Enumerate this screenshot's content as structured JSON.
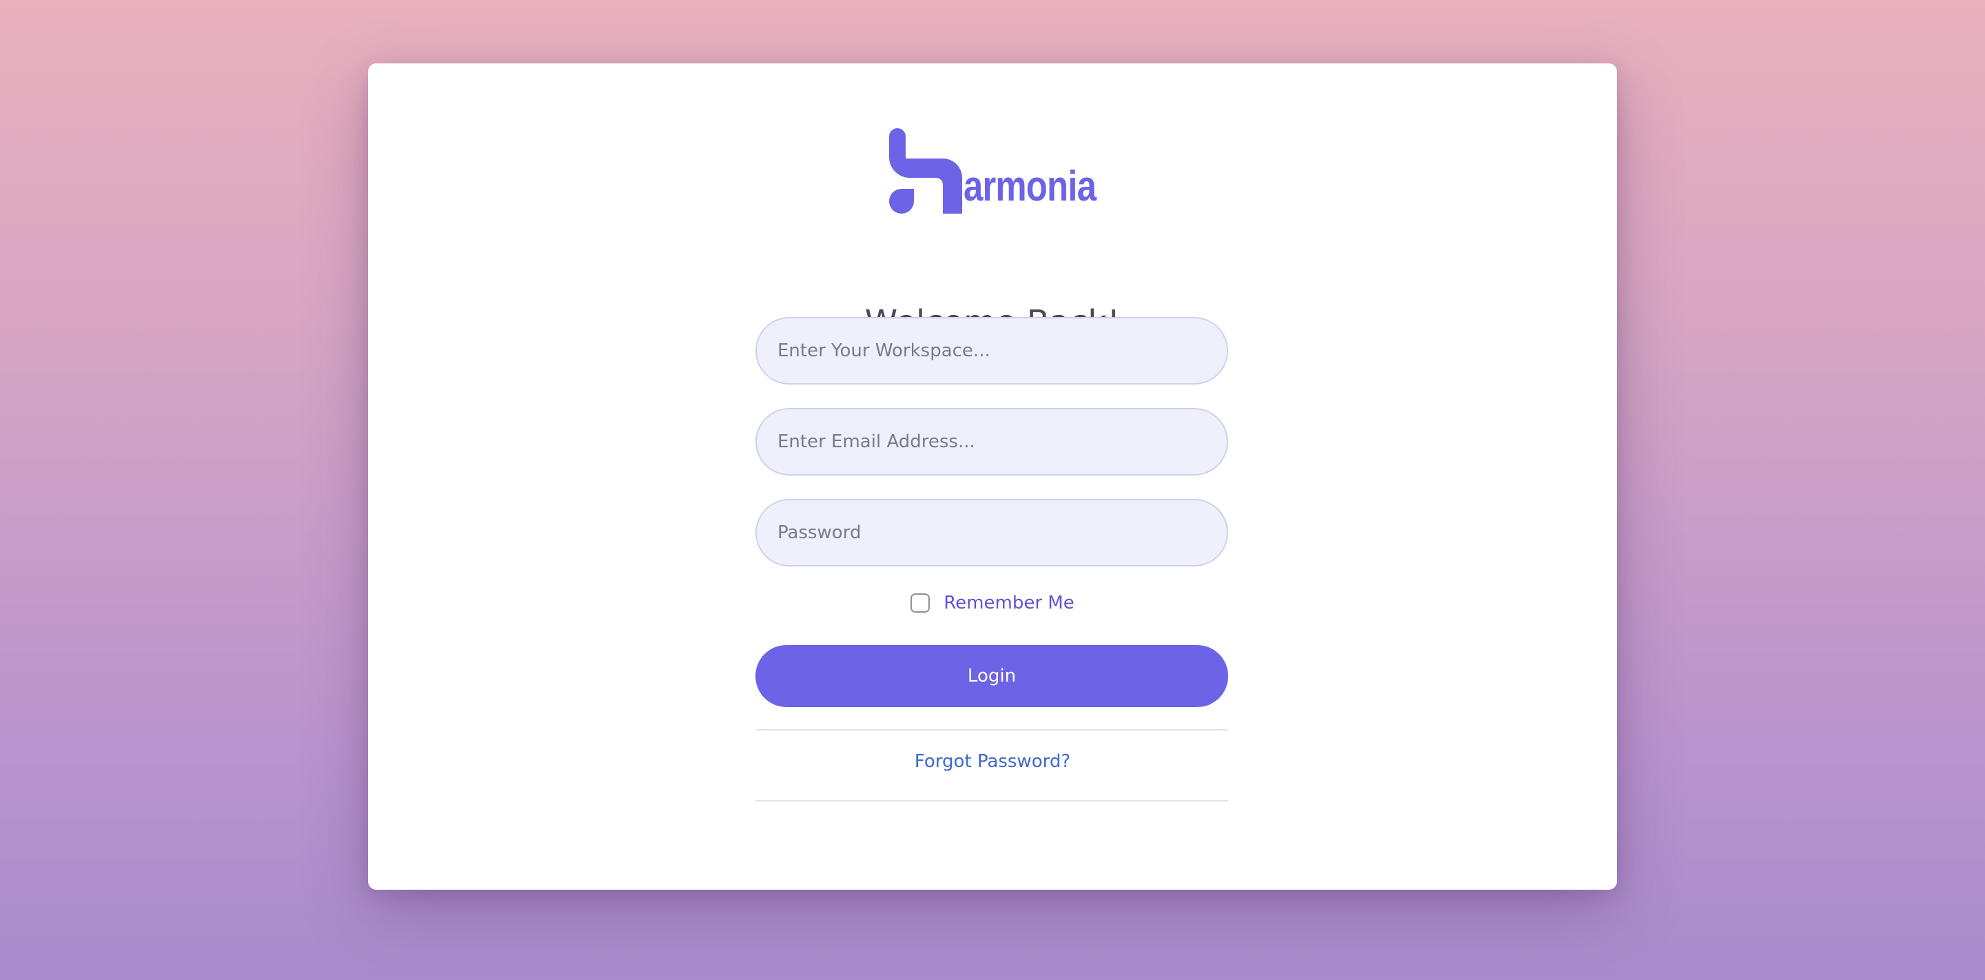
{
  "brand": {
    "name": "armonia",
    "logo_icon": "harmonia-h-logo-icon",
    "color": "#6c63e6"
  },
  "heading": "Welcome Back!",
  "form": {
    "workspace_placeholder": "Enter Your Workspace...",
    "email_placeholder": "Enter Email Address...",
    "password_placeholder": "Password",
    "remember_label": "Remember Me",
    "remember_checked": false,
    "login_label": "Login",
    "forgot_label": "Forgot Password?"
  },
  "colors": {
    "accent": "#6d63e6",
    "link": "#3e68cc",
    "background_top": "#e9b1bd",
    "background_bottom": "#a88ccc"
  }
}
